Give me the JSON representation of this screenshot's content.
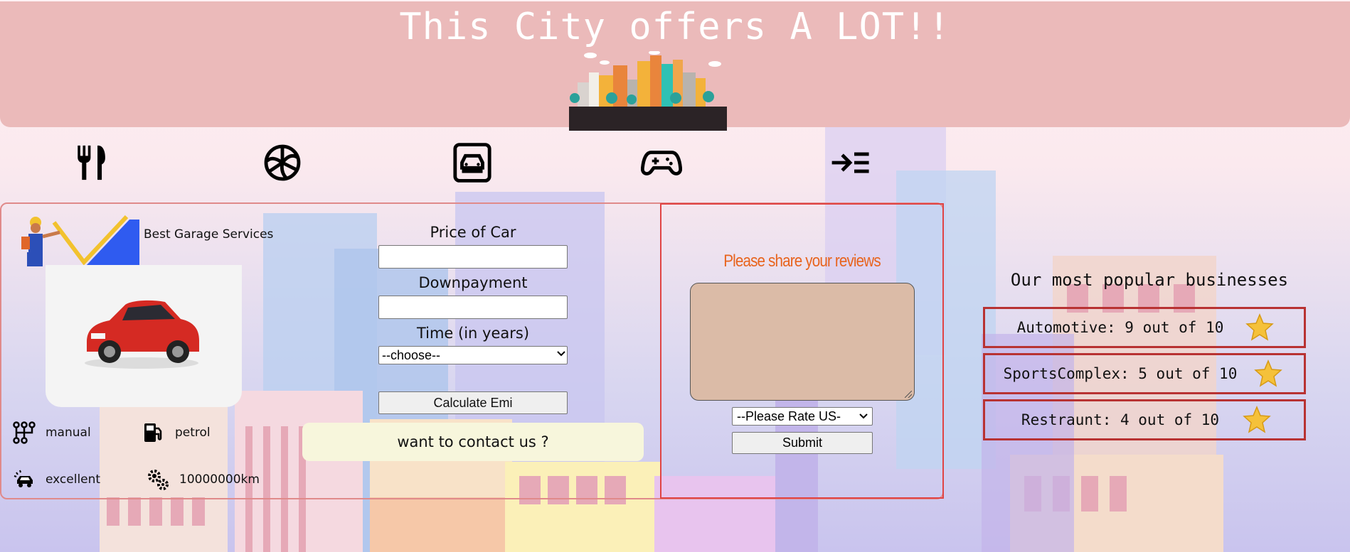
{
  "header": {
    "title": "This City offers A LOT!!"
  },
  "nav": {
    "items": [
      {
        "name": "restaurant",
        "icon": "fork-knife-icon"
      },
      {
        "name": "sports",
        "icon": "volleyball-icon"
      },
      {
        "name": "automotive",
        "icon": "car-icon"
      },
      {
        "name": "games",
        "icon": "gamepad-icon"
      },
      {
        "name": "menu",
        "icon": "indent-menu-icon"
      }
    ]
  },
  "garage": {
    "name": "Best Garage Services",
    "specs": {
      "transmission": "manual",
      "fuel": "petrol",
      "condition": "excellent",
      "mileage": "10000000km"
    },
    "emi": {
      "price_label": "Price of Car",
      "price_value": "",
      "downpayment_label": "Downpayment",
      "downpayment_value": "",
      "time_label": "Time (in years)",
      "time_selected": "--choose--",
      "calculate_label": "Calculate Emi"
    },
    "contact_label": "want to contact us ?"
  },
  "reviews": {
    "title": "Please share your reviews",
    "text_value": "",
    "rate_selected": "--Please Rate US-",
    "submit_label": "Submit"
  },
  "popular": {
    "title": "Our most popular businesses",
    "items": [
      {
        "label": "Automotive: 9 out of 10"
      },
      {
        "label": "SportsComplex: 5 out of 10"
      },
      {
        "label": "Restraunt: 4 out of 10"
      }
    ]
  },
  "colors": {
    "header_bg": "#ebbaba",
    "review_border": "#e04444",
    "review_title": "#e8641e",
    "business_border": "#b83232",
    "contact_bg": "#f7f6dc"
  }
}
